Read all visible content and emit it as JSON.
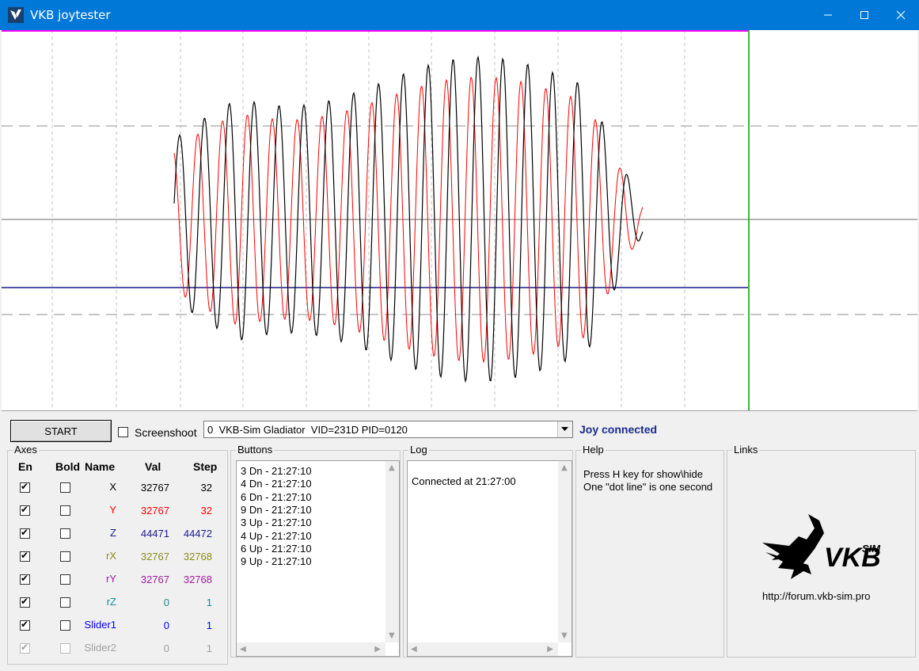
{
  "window": {
    "title": "VKB joytester"
  },
  "toolbar": {
    "start_label": "START",
    "screenshoot_label": "Screenshoot",
    "screenshoot_checked": false,
    "device_selected": "0  VKB-Sim Gladiator  VID=231D PID=0120",
    "status": "Joy connected"
  },
  "axes": {
    "title": "Axes",
    "headers": {
      "en": "En",
      "bold": "Bold",
      "name": "Name",
      "val": "Val",
      "step": "Step"
    },
    "rows": [
      {
        "name": "X",
        "val": "32767",
        "step": "32",
        "color": "#000000",
        "enabled": true,
        "bold": false,
        "disabled": false
      },
      {
        "name": "Y",
        "val": "32767",
        "step": "32",
        "color": "#ff0000",
        "enabled": true,
        "bold": false,
        "disabled": false
      },
      {
        "name": "Z",
        "val": "44471",
        "step": "44472",
        "color": "#1a1a8c",
        "enabled": true,
        "bold": false,
        "disabled": false
      },
      {
        "name": "rX",
        "val": "32767",
        "step": "32768",
        "color": "#8c8c1a",
        "enabled": true,
        "bold": false,
        "disabled": false
      },
      {
        "name": "rY",
        "val": "32767",
        "step": "32768",
        "color": "#a01aa0",
        "enabled": true,
        "bold": false,
        "disabled": false
      },
      {
        "name": "rZ",
        "val": "0",
        "step": "1",
        "color": "#1a8c8c",
        "enabled": true,
        "bold": false,
        "disabled": false
      },
      {
        "name": "Slider1",
        "val": "0",
        "step": "1",
        "color": "#0000ff",
        "enabled": true,
        "bold": false,
        "disabled": false
      },
      {
        "name": "Slider2",
        "val": "0",
        "step": "1",
        "color": "#a0a0a0",
        "enabled": true,
        "bold": false,
        "disabled": true
      }
    ]
  },
  "buttons": {
    "title": "Buttons",
    "items": [
      "3 Dn - 21:27:10",
      "4 Dn - 21:27:10",
      "6 Dn - 21:27:10",
      "9 Dn - 21:27:10",
      "3 Up - 21:27:10",
      "4 Up - 21:27:10",
      "6 Up - 21:27:10",
      "9 Up - 21:27:10"
    ]
  },
  "log": {
    "title": "Log",
    "items": [
      "Connected at 21:27:00"
    ]
  },
  "help": {
    "title": "Help",
    "lines": [
      "Press H key for show\\hide",
      "One \"dot line\" is one second"
    ]
  },
  "links": {
    "title": "Links",
    "logo_text": "VKB SIM",
    "url": "http://forum.vkb-sim.pro"
  },
  "colors": {
    "titlebar": "#0078d7",
    "trace_x": "#000000",
    "trace_y": "#ff0000",
    "trace_z": "#1a1a8c",
    "cursor": "#00a000"
  }
}
